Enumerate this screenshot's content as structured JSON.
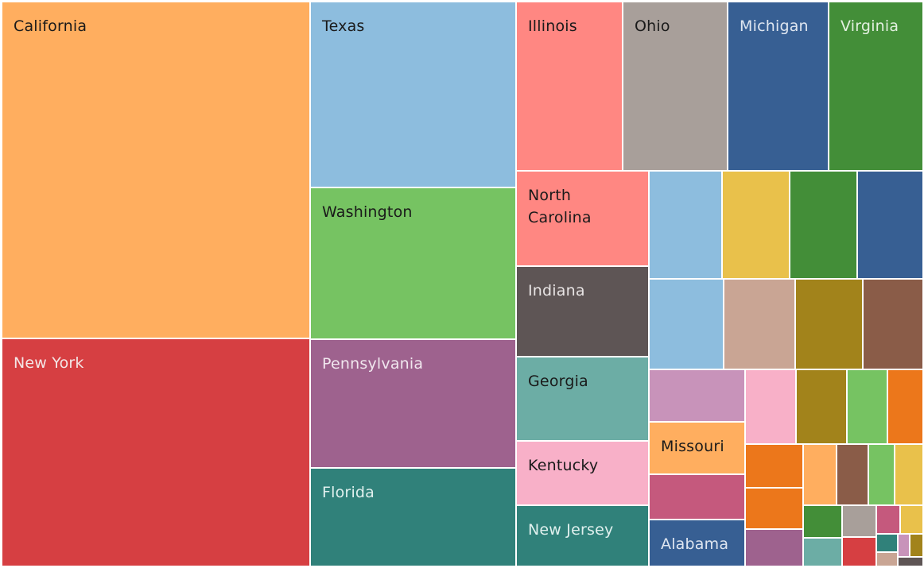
{
  "chart_data": {
    "type": "treemap",
    "title": "",
    "size_measure": "relative area (unlabeled values)",
    "palette": {
      "orange": "#FFAE5F",
      "red": "#D63F42",
      "light_blue": "#8DBDDE",
      "green": "#76C362",
      "purple": "#9E628E",
      "teal_dark": "#30817A",
      "salmon": "#FF8782",
      "gray": "#A89F9A",
      "blue": "#375F93",
      "dark_green": "#438E38",
      "charcoal": "#5E5555",
      "teal": "#6CADA5",
      "pink": "#F8B0C8",
      "yellow": "#E9C14B",
      "tan": "#C9A594",
      "olive": "#A2831B",
      "brown": "#8A5C48",
      "lilac": "#C893BA",
      "rose": "#C5597D",
      "bright_orange": "#EC771B"
    },
    "tiles": [
      {
        "label": "California",
        "color": "#FFAE5F",
        "text_color": "#1a1a1a"
      },
      {
        "label": "New York",
        "color": "#D63F42",
        "text_color": "#f3e6e6"
      },
      {
        "label": "Texas",
        "color": "#8DBDDE",
        "text_color": "#1a1a1a"
      },
      {
        "label": "Washington",
        "color": "#76C362",
        "text_color": "#1a1a1a"
      },
      {
        "label": "Pennsylvania",
        "color": "#9E628E",
        "text_color": "#f0e6ee"
      },
      {
        "label": "Florida",
        "color": "#30817A",
        "text_color": "#e0f0ee"
      },
      {
        "label": "Illinois",
        "color": "#FF8782",
        "text_color": "#1a1a1a"
      },
      {
        "label": "Ohio",
        "color": "#A89F9A",
        "text_color": "#1a1a1a"
      },
      {
        "label": "Michigan",
        "color": "#375F93",
        "text_color": "#dfe6f0"
      },
      {
        "label": "Virginia",
        "color": "#438E38",
        "text_color": "#e3f0e0"
      },
      {
        "label": "North\nCarolina",
        "color": "#FF8782",
        "text_color": "#1a1a1a"
      },
      {
        "label": "Indiana",
        "color": "#5E5555",
        "text_color": "#e8e4e4"
      },
      {
        "label": "Georgia",
        "color": "#6CADA5",
        "text_color": "#1a1a1a"
      },
      {
        "label": "Kentucky",
        "color": "#F8B0C8",
        "text_color": "#1a1a1a"
      },
      {
        "label": "New Jersey",
        "color": "#30817A",
        "text_color": "#e0f0ee"
      },
      {
        "label": "",
        "color": "#8DBDDE",
        "text_color": "#1a1a1a"
      },
      {
        "label": "",
        "color": "#E9C14B",
        "text_color": "#1a1a1a"
      },
      {
        "label": "",
        "color": "#438E38",
        "text_color": "#1a1a1a"
      },
      {
        "label": "",
        "color": "#375F93",
        "text_color": "#1a1a1a"
      },
      {
        "label": "",
        "color": "#8DBDDE",
        "text_color": "#1a1a1a"
      },
      {
        "label": "",
        "color": "#C9A594",
        "text_color": "#1a1a1a"
      },
      {
        "label": "",
        "color": "#A2831B",
        "text_color": "#1a1a1a"
      },
      {
        "label": "",
        "color": "#8A5C48",
        "text_color": "#1a1a1a"
      },
      {
        "label": "",
        "color": "#C893BA",
        "text_color": "#1a1a1a"
      },
      {
        "label": "Missouri",
        "color": "#FFAE5F",
        "text_color": "#1a1a1a"
      },
      {
        "label": "",
        "color": "#C5597D",
        "text_color": "#1a1a1a"
      },
      {
        "label": "Alabama",
        "color": "#375F93",
        "text_color": "#dfe6f0"
      },
      {
        "label": "",
        "color": "#F8B0C8",
        "text_color": "#1a1a1a"
      },
      {
        "label": "",
        "color": "#A2831B",
        "text_color": "#1a1a1a"
      },
      {
        "label": "",
        "color": "#76C362",
        "text_color": "#1a1a1a"
      },
      {
        "label": "",
        "color": "#EC771B",
        "text_color": "#1a1a1a"
      },
      {
        "label": "",
        "color": "#EC771B",
        "text_color": "#1a1a1a"
      },
      {
        "label": "",
        "color": "#EC771B",
        "text_color": "#1a1a1a"
      },
      {
        "label": "",
        "color": "#9E628E",
        "text_color": "#1a1a1a"
      },
      {
        "label": "",
        "color": "#FFAE5F",
        "text_color": "#1a1a1a"
      },
      {
        "label": "",
        "color": "#8A5C48",
        "text_color": "#1a1a1a"
      },
      {
        "label": "",
        "color": "#76C362",
        "text_color": "#1a1a1a"
      },
      {
        "label": "",
        "color": "#E9C14B",
        "text_color": "#1a1a1a"
      },
      {
        "label": "",
        "color": "#438E38",
        "text_color": "#1a1a1a"
      },
      {
        "label": "",
        "color": "#6CADA5",
        "text_color": "#1a1a1a"
      },
      {
        "label": "",
        "color": "#A89F9A",
        "text_color": "#1a1a1a"
      },
      {
        "label": "",
        "color": "#D63F42",
        "text_color": "#1a1a1a"
      },
      {
        "label": "",
        "color": "#C5597D",
        "text_color": "#1a1a1a"
      },
      {
        "label": "",
        "color": "#E9C14B",
        "text_color": "#1a1a1a"
      },
      {
        "label": "",
        "color": "#30817A",
        "text_color": "#1a1a1a"
      },
      {
        "label": "",
        "color": "#C9A594",
        "text_color": "#1a1a1a"
      },
      {
        "label": "",
        "color": "#C893BA",
        "text_color": "#1a1a1a"
      },
      {
        "label": "",
        "color": "#A2831B",
        "text_color": "#1a1a1a"
      },
      {
        "label": "",
        "color": "#5E5555",
        "text_color": "#1a1a1a"
      }
    ]
  }
}
